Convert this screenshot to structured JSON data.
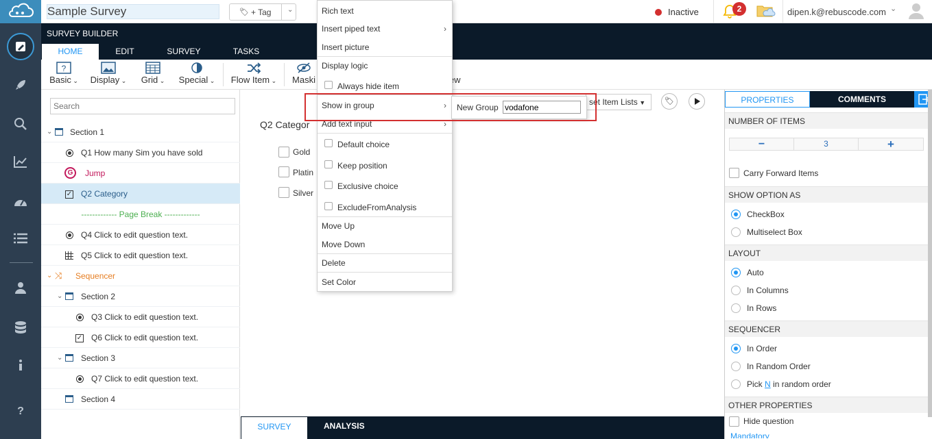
{
  "app": {
    "title": "Sample Survey",
    "tag_label": "+ Tag",
    "status": "Inactive",
    "notifications": "2",
    "user": "dipen.k@rebuscode.com"
  },
  "builder": {
    "title": "SURVEY BUILDER",
    "tabs": [
      "HOME",
      "EDIT",
      "SURVEY",
      "TASKS"
    ]
  },
  "ribbon": {
    "items": [
      "Basic",
      "Display",
      "Grid",
      "Special",
      "Flow Item",
      "Maski",
      "iew"
    ]
  },
  "sidebar": {
    "search_placeholder": "Search",
    "tree": [
      {
        "label": "Section 1"
      },
      {
        "label": "Q1 How many Sim you have sold"
      },
      {
        "label": "Jump"
      },
      {
        "label": "Q2 Category"
      },
      {
        "label": "------------- Page Break -------------"
      },
      {
        "label": "Q4 Click to edit question text."
      },
      {
        "label": "Q5 Click to edit question text."
      },
      {
        "label": "Sequencer"
      },
      {
        "label": "Section 2"
      },
      {
        "label": "Q3 Click to edit question text."
      },
      {
        "label": "Q6 Click to edit question text."
      },
      {
        "label": "Section 3"
      },
      {
        "label": "Q7 Click to edit question text."
      },
      {
        "label": "Section 4"
      }
    ]
  },
  "canvas": {
    "question": "Q2  Categor",
    "options": [
      "Gold",
      "Platin",
      "Silver"
    ],
    "toolbar_label": "set Item Lists"
  },
  "bottom_tabs": [
    "SURVEY",
    "ANALYSIS"
  ],
  "context_menu": {
    "items": [
      "Rich text",
      "Insert piped text",
      "Insert picture",
      "Display logic",
      "Always hide item",
      "Show in group",
      "Add text input",
      "Default choice",
      "Keep position",
      "Exclusive choice",
      "ExcludeFromAnalysis",
      "Move Up",
      "Move Down",
      "Delete",
      "Set Color"
    ],
    "submenu": {
      "label": "New Group",
      "value": "vodafone"
    }
  },
  "properties": {
    "tabs": [
      "PROPERTIES",
      "COMMENTS"
    ],
    "number_of_items_label": "NUMBER OF ITEMS",
    "minus": "−",
    "count": "3",
    "plus": "+",
    "carry_forward": "Carry Forward Items",
    "show_option_as": {
      "title": "SHOW OPTION AS",
      "options": [
        "CheckBox",
        "Multiselect Box"
      ]
    },
    "layout": {
      "title": "LAYOUT",
      "options": [
        "Auto",
        "In Columns",
        "In Rows"
      ]
    },
    "sequencer": {
      "title": "SEQUENCER",
      "options": [
        "In Order",
        "In Random Order",
        "Pick",
        "N",
        "in random order"
      ]
    },
    "other": {
      "title": "OTHER PROPERTIES",
      "hide_question": "Hide question",
      "mandatory": "Mandatory"
    }
  },
  "colors": {
    "accent": "#2196f3",
    "dark": "#0b1a29",
    "nav": "#2d3e50",
    "highlight": "#d32f2f",
    "link": "#c2185b",
    "green": "#4caf50",
    "orange": "#e67e22"
  }
}
